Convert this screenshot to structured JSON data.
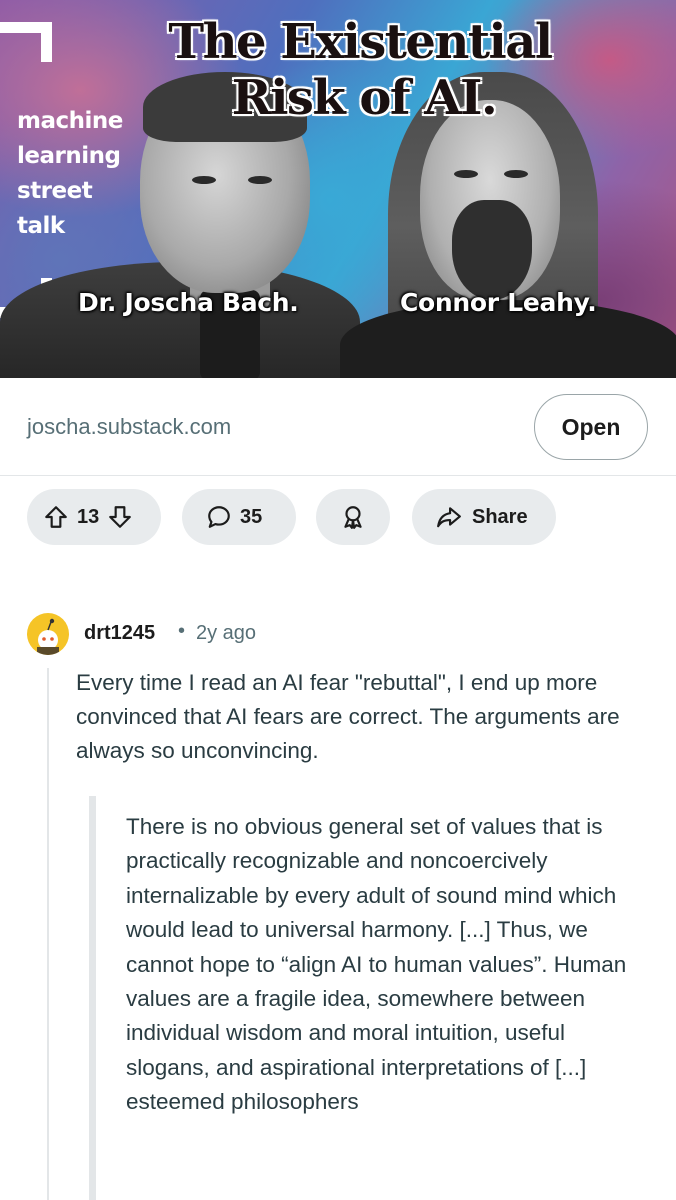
{
  "banner": {
    "title_line1": "The Existential",
    "title_line2": "Risk of AI.",
    "channel_name_lines": [
      "machine",
      "learning",
      "street",
      "talk"
    ],
    "guest_left": "Dr. Joscha Bach.",
    "guest_right": "Connor Leahy."
  },
  "link": {
    "domain": "joscha.substack.com",
    "open_label": "Open"
  },
  "actions": {
    "upvote_icon": "arrow-up-icon",
    "vote_count": "13",
    "downvote_icon": "arrow-down-icon",
    "comment_icon": "speech-bubble-icon",
    "comment_count": "35",
    "award_icon": "award-ribbon-icon",
    "share_icon": "share-arrow-icon",
    "share_label": "Share"
  },
  "comment": {
    "username": "drt1245",
    "separator": "•",
    "time_ago": "2y ago",
    "body": "Every time I read an AI fear \"rebuttal\", I end up more convinced that AI fears are correct. The arguments are always so unconvincing.",
    "quote": "There is no obvious general set of values that is practically recognizable and noncoercively internalizable by every adult of sound mind which would lead to universal harmony. [...] Thus, we cannot hope to “align AI to human values”. Human values are a fragile idea, somewhere between individual wisdom and moral intuition, useful slogans, and aspirational interpretations of [...] esteemed philosophers"
  },
  "colors": {
    "pill_bg": "#e8ebed",
    "muted_text": "#576f76",
    "avatar_bg": "#f5c427",
    "body_text": "#2a3c42"
  }
}
